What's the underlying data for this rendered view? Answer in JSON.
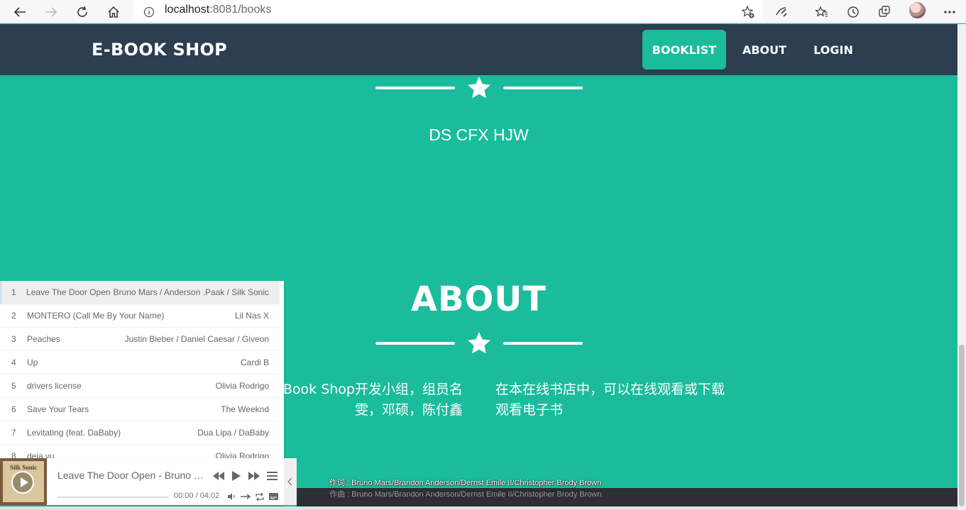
{
  "browser": {
    "url_host": "localhost",
    "url_rest": ":8081/books"
  },
  "nav": {
    "brand": "E-BOOK SHOP",
    "links": [
      {
        "label": "BOOKLIST",
        "active": true
      },
      {
        "label": "ABOUT",
        "active": false
      },
      {
        "label": "LOGIN",
        "active": false
      }
    ]
  },
  "hero": {
    "team": "DS CFX HJW"
  },
  "about": {
    "title": "ABOUT",
    "col_left": "Book Shop开发小组，组员名\n雯，邓硕，陈付鑫",
    "col_right": "在本在线书店中，可以在线观看或下载观看电子书"
  },
  "playlist": [
    {
      "num": "1",
      "title": "Leave The Door Open",
      "artist": "Bruno Mars / Anderson .Paak / Silk Sonic"
    },
    {
      "num": "2",
      "title": "MONTERO (Call Me By Your Name)",
      "artist": "Lil Nas X"
    },
    {
      "num": "3",
      "title": "Peaches",
      "artist": "Justin Bieber / Daniel Caesar / Giveon"
    },
    {
      "num": "4",
      "title": "Up",
      "artist": "Cardi B"
    },
    {
      "num": "5",
      "title": "drivers license",
      "artist": "Olivia Rodrigo"
    },
    {
      "num": "6",
      "title": "Save Your Tears",
      "artist": "The Weeknd"
    },
    {
      "num": "7",
      "title": "Levitating (feat. DaBaby)",
      "artist": "Dua Lipa / DaBaby"
    },
    {
      "num": "8",
      "title": "deja vu",
      "artist": "Olivia Rodrigo"
    }
  ],
  "player": {
    "cover_text": "Silk Sonic",
    "now_playing": "Leave The Door Open - Bruno Mars / Anderson .Paak / Silk Sonic",
    "time": "00:00 / 04:02",
    "progress": 0.0
  },
  "lyrics": {
    "line1": "作词 : Bruno Mars/Brandon Anderson/Dernst Emile II/Christopher Brody Brown",
    "line2": "作曲 : Bruno Mars/Brandon Anderson/Dernst Emile II/Christopher Brody Brown"
  },
  "colors": {
    "accent": "#1abc9c",
    "navbar": "#2c3e50"
  }
}
